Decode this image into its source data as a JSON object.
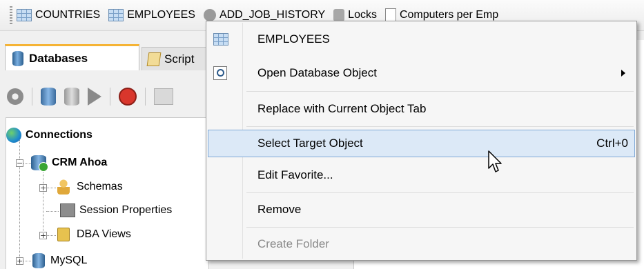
{
  "favorites_bar": {
    "items": [
      {
        "label": "COUNTRIES",
        "icon": "table-icon"
      },
      {
        "label": "EMPLOYEES",
        "icon": "table-icon"
      },
      {
        "label": "ADD_JOB_HISTORY",
        "icon": "procedure-icon"
      },
      {
        "label": "Locks",
        "icon": "lock-search-icon"
      },
      {
        "label": "Computers per Emp",
        "icon": "document-icon"
      }
    ]
  },
  "left_tabs": {
    "databases": "Databases",
    "scripts": "Script"
  },
  "tree": {
    "connections": "Connections",
    "crm": "CRM Ahoa",
    "schemas": "Schemas",
    "session_properties": "Session Properties",
    "dba_views": "DBA Views",
    "mysql": "MySQL"
  },
  "context_menu": {
    "header": "EMPLOYEES",
    "items": [
      {
        "label": "Open Database Object",
        "shortcut": "",
        "submenu": true,
        "enabled": true
      },
      {
        "label": "Replace with Current Object Tab",
        "shortcut": "",
        "submenu": false,
        "enabled": true
      },
      {
        "label": "Select Target Object",
        "shortcut": "Ctrl+0",
        "submenu": false,
        "enabled": true,
        "highlighted": true
      },
      {
        "label": "Edit Favorite...",
        "shortcut": "",
        "submenu": false,
        "enabled": true
      },
      {
        "label": "Remove",
        "shortcut": "",
        "submenu": false,
        "enabled": true
      },
      {
        "label": "Create Folder",
        "shortcut": "",
        "submenu": false,
        "enabled": false
      }
    ]
  },
  "colors": {
    "highlight_bg": "#dce9f7",
    "highlight_border": "#7fa8d6",
    "active_tab_accent": "#f5b335"
  }
}
